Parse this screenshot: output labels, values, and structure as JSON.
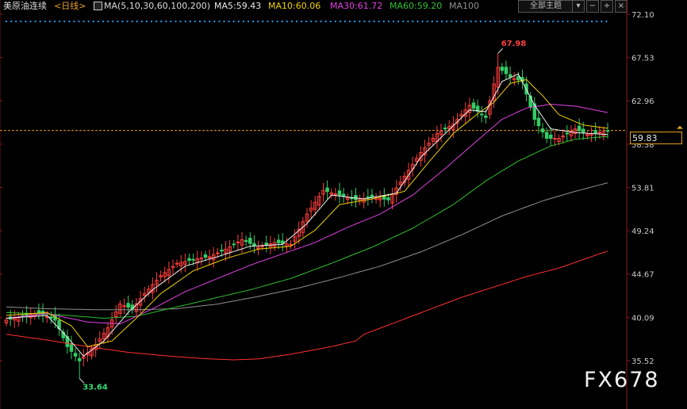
{
  "header": {
    "instrument": "美原油连续",
    "period": "<日线>",
    "ma_set": "MA(5,10,30,60,100,200)",
    "ma5": "MA5:59.43",
    "ma10": "MA10:60.06",
    "ma30": "MA30:61.72",
    "ma60": "MA60:59.20",
    "ma100": "MA100",
    "mode_button": "全部主题",
    "icon_names": [
      "checkbox-icon",
      "minus-icon",
      "plus-icon",
      "close-icon",
      "grid-icon"
    ]
  },
  "colors": {
    "up": "#ff3b3b",
    "down": "#33cc66",
    "ma5": "#f0f0f0",
    "ma10": "#f0d000",
    "ma30": "#e040e0",
    "ma60": "#30c030",
    "ma100": "#909090",
    "ma200": "#ff3030",
    "dotline": "#2aa0ff",
    "price_line": "#e0a020"
  },
  "watermark": "FX678",
  "current_price": "59.83",
  "chart_data": {
    "type": "candlestick",
    "title": "美原油连续",
    "ylim": [
      33.0,
      72.1
    ],
    "y_ticks": [
      {
        "value": 72.1,
        "label": "72.10"
      },
      {
        "value": 67.53,
        "label": "67.53"
      },
      {
        "value": 62.96,
        "label": "62.96"
      },
      {
        "value": 58.38,
        "label": "58.38"
      },
      {
        "value": 53.81,
        "label": "53.81"
      },
      {
        "value": 49.24,
        "label": "49.24"
      },
      {
        "value": 44.67,
        "label": "44.67"
      },
      {
        "value": 40.09,
        "label": "40.09"
      },
      {
        "value": 35.52,
        "label": "35.52"
      }
    ],
    "current_price": 59.83,
    "annotations": [
      {
        "label": "67.98",
        "value": 67.98,
        "type": "high",
        "index": 121
      },
      {
        "label": "33.64",
        "value": 33.64,
        "type": "low",
        "index": 18
      }
    ],
    "series_anchors": {
      "close": [
        [
          0,
          39.8
        ],
        [
          4,
          40.2
        ],
        [
          8,
          40.6
        ],
        [
          12,
          39.8
        ],
        [
          15,
          37.0
        ],
        [
          18,
          35.5
        ],
        [
          22,
          37.2
        ],
        [
          25,
          39.0
        ],
        [
          28,
          41.5
        ],
        [
          31,
          41.0
        ],
        [
          34,
          42.6
        ],
        [
          38,
          44.5
        ],
        [
          42,
          45.8
        ],
        [
          46,
          46.2
        ],
        [
          50,
          46.5
        ],
        [
          54,
          47.3
        ],
        [
          58,
          48.3
        ],
        [
          62,
          47.5
        ],
        [
          66,
          48.0
        ],
        [
          70,
          47.8
        ],
        [
          74,
          51.0
        ],
        [
          78,
          53.5
        ],
        [
          82,
          53.0
        ],
        [
          86,
          52.5
        ],
        [
          90,
          52.8
        ],
        [
          94,
          52.5
        ],
        [
          98,
          55.0
        ],
        [
          102,
          57.5
        ],
        [
          106,
          59.5
        ],
        [
          110,
          60.5
        ],
        [
          114,
          62.5
        ],
        [
          118,
          61.2
        ],
        [
          121,
          66.5
        ],
        [
          124,
          65.5
        ],
        [
          127,
          65.0
        ],
        [
          130,
          61.0
        ],
        [
          133,
          59.0
        ],
        [
          136,
          59.0
        ],
        [
          140,
          60.0
        ],
        [
          143,
          59.4
        ],
        [
          148,
          59.8
        ]
      ],
      "ma5": [
        [
          0,
          40.0
        ],
        [
          10,
          40.3
        ],
        [
          15,
          38.0
        ],
        [
          19,
          36.0
        ],
        [
          24,
          37.6
        ],
        [
          30,
          40.6
        ],
        [
          36,
          43.0
        ],
        [
          44,
          45.5
        ],
        [
          52,
          46.5
        ],
        [
          60,
          47.6
        ],
        [
          68,
          47.8
        ],
        [
          74,
          50.0
        ],
        [
          80,
          53.0
        ],
        [
          88,
          52.6
        ],
        [
          96,
          53.2
        ],
        [
          102,
          57.0
        ],
        [
          108,
          59.5
        ],
        [
          114,
          62.0
        ],
        [
          118,
          61.8
        ],
        [
          122,
          65.0
        ],
        [
          126,
          65.8
        ],
        [
          130,
          62.5
        ],
        [
          134,
          60.0
        ],
        [
          140,
          59.6
        ],
        [
          148,
          59.4
        ]
      ],
      "ma10": [
        [
          0,
          40.3
        ],
        [
          10,
          40.6
        ],
        [
          16,
          39.2
        ],
        [
          20,
          37.0
        ],
        [
          26,
          37.6
        ],
        [
          32,
          40.0
        ],
        [
          38,
          42.6
        ],
        [
          46,
          45.0
        ],
        [
          54,
          46.3
        ],
        [
          62,
          47.3
        ],
        [
          70,
          47.6
        ],
        [
          76,
          49.3
        ],
        [
          82,
          52.0
        ],
        [
          90,
          52.6
        ],
        [
          98,
          53.4
        ],
        [
          104,
          56.5
        ],
        [
          110,
          59.5
        ],
        [
          116,
          61.6
        ],
        [
          120,
          62.8
        ],
        [
          124,
          64.8
        ],
        [
          128,
          65.2
        ],
        [
          132,
          63.5
        ],
        [
          136,
          61.5
        ],
        [
          142,
          60.4
        ],
        [
          148,
          60.06
        ]
      ],
      "ma30": [
        [
          0,
          40.0
        ],
        [
          10,
          40.5
        ],
        [
          20,
          39.6
        ],
        [
          28,
          39.4
        ],
        [
          36,
          41.0
        ],
        [
          44,
          42.8
        ],
        [
          52,
          44.2
        ],
        [
          60,
          45.6
        ],
        [
          68,
          46.8
        ],
        [
          76,
          48.0
        ],
        [
          84,
          49.6
        ],
        [
          92,
          51.0
        ],
        [
          100,
          53.0
        ],
        [
          108,
          55.8
        ],
        [
          116,
          58.8
        ],
        [
          122,
          61.0
        ],
        [
          128,
          62.2
        ],
        [
          134,
          62.6
        ],
        [
          140,
          62.4
        ],
        [
          148,
          61.72
        ]
      ],
      "ma60": [
        [
          0,
          40.6
        ],
        [
          12,
          40.4
        ],
        [
          24,
          40.0
        ],
        [
          32,
          40.2
        ],
        [
          40,
          41.0
        ],
        [
          50,
          42.0
        ],
        [
          60,
          43.0
        ],
        [
          70,
          44.2
        ],
        [
          80,
          45.8
        ],
        [
          90,
          47.5
        ],
        [
          100,
          49.5
        ],
        [
          110,
          52.0
        ],
        [
          118,
          54.5
        ],
        [
          126,
          56.6
        ],
        [
          134,
          58.2
        ],
        [
          140,
          58.9
        ],
        [
          148,
          59.2
        ]
      ],
      "ma100": [
        [
          0,
          41.2
        ],
        [
          10,
          41.0
        ],
        [
          22,
          40.9
        ],
        [
          32,
          40.9
        ],
        [
          42,
          41.0
        ],
        [
          52,
          41.5
        ],
        [
          62,
          42.3
        ],
        [
          72,
          43.2
        ],
        [
          82,
          44.3
        ],
        [
          92,
          45.5
        ],
        [
          102,
          47.0
        ],
        [
          112,
          48.8
        ],
        [
          122,
          50.8
        ],
        [
          132,
          52.4
        ],
        [
          140,
          53.4
        ],
        [
          148,
          54.3
        ]
      ],
      "ma200": [
        [
          0,
          38.3
        ],
        [
          10,
          37.7
        ],
        [
          20,
          37.0
        ],
        [
          30,
          36.4
        ],
        [
          40,
          36.0
        ],
        [
          50,
          35.7
        ],
        [
          56,
          35.6
        ],
        [
          62,
          35.7
        ],
        [
          70,
          36.2
        ],
        [
          80,
          37.0
        ],
        [
          86,
          37.6
        ],
        [
          88,
          38.3
        ],
        [
          96,
          39.6
        ],
        [
          104,
          40.9
        ],
        [
          112,
          42.2
        ],
        [
          120,
          43.3
        ],
        [
          128,
          44.4
        ],
        [
          136,
          45.3
        ],
        [
          142,
          46.2
        ],
        [
          148,
          47.1
        ]
      ]
    }
  }
}
